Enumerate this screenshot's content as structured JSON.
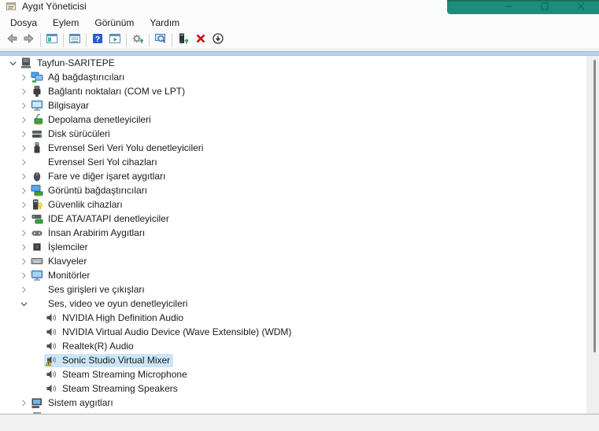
{
  "window": {
    "title": "Aygıt Yöneticisi",
    "accent_teal": "#1f8b7a",
    "controls": [
      {
        "name": "minimize"
      },
      {
        "name": "maximize"
      },
      {
        "name": "close"
      }
    ]
  },
  "menu": {
    "items": [
      {
        "label": "Dosya"
      },
      {
        "label": "Eylem"
      },
      {
        "label": "Görünüm"
      },
      {
        "label": "Yardım"
      }
    ]
  },
  "toolbar": {
    "groups": [
      [
        {
          "icon": "back"
        },
        {
          "icon": "forward"
        }
      ],
      [
        {
          "icon": "console-tree"
        }
      ],
      [
        {
          "icon": "properties"
        }
      ],
      [
        {
          "icon": "help"
        },
        {
          "icon": "action-pane"
        }
      ],
      [
        {
          "icon": "update-driver"
        }
      ],
      [
        {
          "icon": "scan-hardware"
        }
      ],
      [
        {
          "icon": "device-driver"
        },
        {
          "icon": "uninstall"
        },
        {
          "icon": "disable"
        }
      ]
    ]
  },
  "tree": {
    "items": [
      {
        "level": 0,
        "state": "expanded",
        "icon": "computer-root",
        "label": "Tayfun-SARITEPE"
      },
      {
        "level": 1,
        "state": "collapsed",
        "icon": "network-adapter",
        "label": "Ağ bağdaştırıcıları"
      },
      {
        "level": 1,
        "state": "collapsed",
        "icon": "ports",
        "label": "Bağlantı noktaları (COM ve LPT)"
      },
      {
        "level": 1,
        "state": "collapsed",
        "icon": "computer",
        "label": "Bilgisayar"
      },
      {
        "level": 1,
        "state": "collapsed",
        "icon": "storage-controller",
        "label": "Depolama denetleyicileri"
      },
      {
        "level": 1,
        "state": "collapsed",
        "icon": "disk-drive",
        "label": "Disk sürücüleri"
      },
      {
        "level": 1,
        "state": "collapsed",
        "icon": "usb-controller",
        "label": "Evrensel Seri Veri Yolu denetleyicileri"
      },
      {
        "level": 1,
        "state": "collapsed",
        "icon": "usb-device",
        "label": "Evrensel Seri Yol cihazları"
      },
      {
        "level": 1,
        "state": "collapsed",
        "icon": "mouse",
        "label": "Fare ve diğer işaret aygıtları"
      },
      {
        "level": 1,
        "state": "collapsed",
        "icon": "display-adapter",
        "label": "Görüntü bağdaştırıcıları"
      },
      {
        "level": 1,
        "state": "collapsed",
        "icon": "security-device",
        "label": "Güvenlik cihazları"
      },
      {
        "level": 1,
        "state": "collapsed",
        "icon": "ide-controller",
        "label": "IDE ATA/ATAPI denetleyiciler"
      },
      {
        "level": 1,
        "state": "collapsed",
        "icon": "hid",
        "label": "İnsan Arabirim Aygıtları"
      },
      {
        "level": 1,
        "state": "collapsed",
        "icon": "processor",
        "label": "İşlemciler"
      },
      {
        "level": 1,
        "state": "collapsed",
        "icon": "keyboard",
        "label": "Klavyeler"
      },
      {
        "level": 1,
        "state": "collapsed",
        "icon": "monitor",
        "label": "Monitörler"
      },
      {
        "level": 1,
        "state": "collapsed",
        "icon": "audio-inout",
        "label": "Ses girişleri ve çıkışları"
      },
      {
        "level": 1,
        "state": "expanded",
        "icon": "audio-controller",
        "label": "Ses, video ve oyun denetleyicileri"
      },
      {
        "level": 2,
        "state": "leaf",
        "icon": "speaker",
        "label": "NVIDIA High Definition Audio"
      },
      {
        "level": 2,
        "state": "leaf",
        "icon": "speaker",
        "label": "NVIDIA Virtual Audio Device (Wave Extensible) (WDM)"
      },
      {
        "level": 2,
        "state": "leaf",
        "icon": "speaker",
        "label": "Realtek(R) Audio"
      },
      {
        "level": 2,
        "state": "leaf",
        "icon": "speaker-warning",
        "label": "Sonic Studio Virtual Mixer",
        "selected": true
      },
      {
        "level": 2,
        "state": "leaf",
        "icon": "speaker",
        "label": "Steam Streaming Microphone"
      },
      {
        "level": 2,
        "state": "leaf",
        "icon": "speaker",
        "label": "Steam Streaming Speakers"
      },
      {
        "level": 1,
        "state": "collapsed",
        "icon": "system-device",
        "label": "Sistem aygıtları"
      },
      {
        "level": 1,
        "state": "collapsed",
        "icon": "unknown",
        "label": ""
      }
    ]
  },
  "colors": {
    "selection": "#cbe6f7",
    "bluebar": "#b9d2ec",
    "scroll_thumb": "#8c8c8c"
  }
}
